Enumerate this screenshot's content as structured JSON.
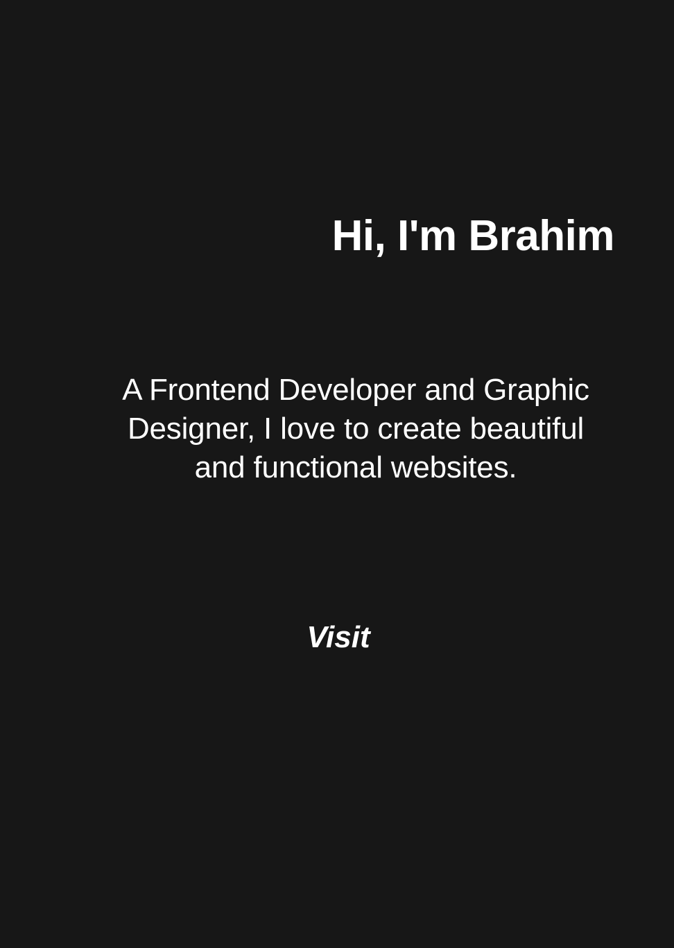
{
  "hero": {
    "title": "Hi, I'm Brahim",
    "description": "A Frontend Developer and Graphic Designer, I love to create beautiful and functional websites.",
    "cta_label": "Visit"
  },
  "colors": {
    "background": "#171717",
    "text": "#ffffff"
  }
}
